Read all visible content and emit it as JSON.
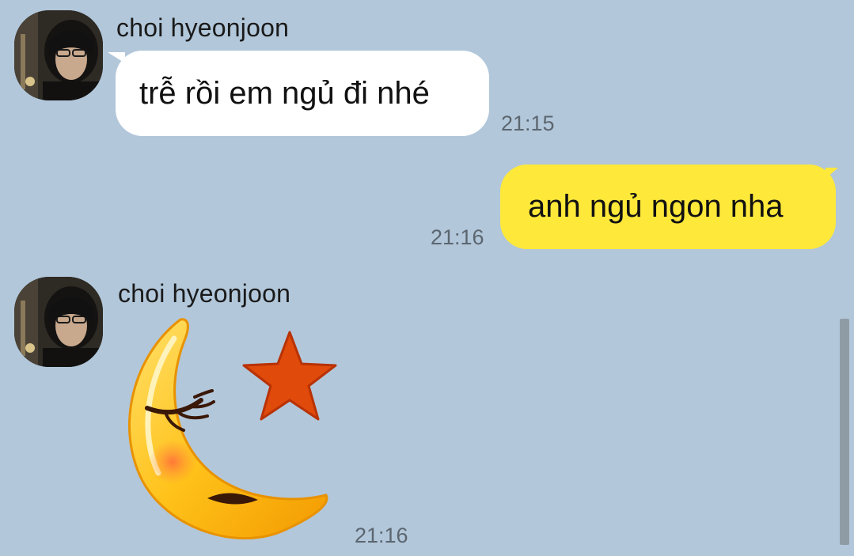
{
  "messages": [
    {
      "sender": "choi hyeonjoon",
      "text": "trễ rồi em ngủ đi nhé",
      "time": "21:15"
    },
    {
      "text": "anh ngủ ngon nha",
      "time": "21:16"
    },
    {
      "sender": "choi hyeonjoon",
      "sticker": "sleeping-moon-star-sticker",
      "time": "21:16"
    }
  ],
  "colors": {
    "background": "#b2c7da",
    "incoming_bubble": "#ffffff",
    "outgoing_bubble": "#fee83a",
    "timestamp": "#5c6670"
  }
}
